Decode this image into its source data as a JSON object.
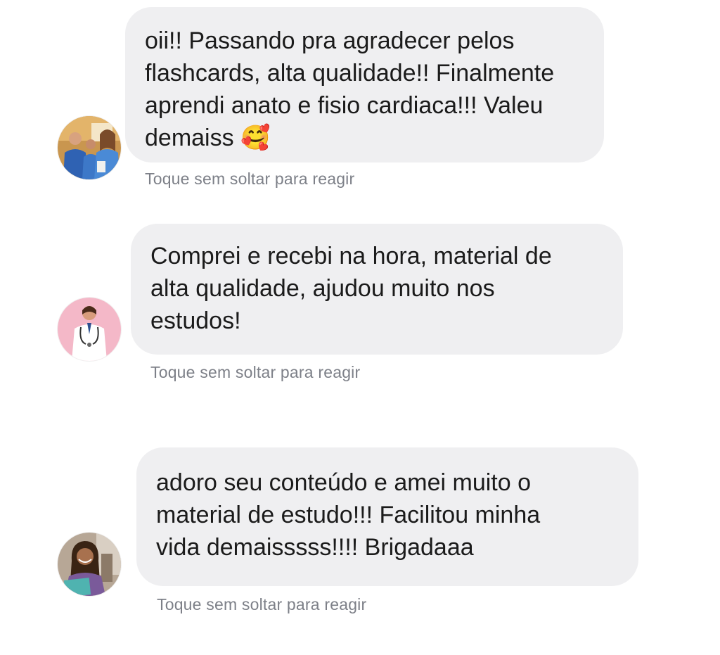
{
  "messages": [
    {
      "avatar_icon": "avatar-nursing-students",
      "text": "oii!! Passando pra agradecer pelos\nflashcards, alta qualidade!! Finalmente\naprendi anato e fisio cardiaca!!! Valeu\ndemaiss ",
      "emoji": "🥰",
      "hint": "Toque sem soltar para reagir"
    },
    {
      "avatar_icon": "avatar-doctor-pink-background",
      "text": "Comprei e recebi na hora, material de\nalta qualidade, ajudou muito nos\nestudos!",
      "hint": "Toque sem soltar para reagir"
    },
    {
      "avatar_icon": "avatar-student-with-book",
      "text": "adoro seu conteúdo e amei muito o\nmaterial de estudo!!! Facilitou minha\nvida demaisssss!!!! Brigadaaa",
      "hint": "Toque sem soltar para reagir"
    }
  ],
  "colors": {
    "bubble": "#efeff1",
    "text": "#1b1b1b",
    "hint": "#7d8088"
  }
}
